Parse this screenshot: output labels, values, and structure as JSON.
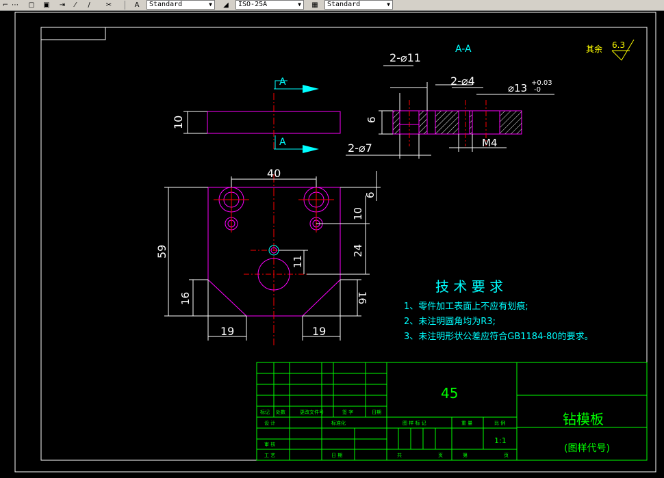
{
  "toolbar": {
    "text_style": "Standard",
    "dim_style": "ISO-25A",
    "table_style": "Standard"
  },
  "drawing": {
    "section_label": "A-A",
    "roughness_other": "其余",
    "roughness_value": "6.3",
    "cut_label_top": "A",
    "cut_label_bottom": "A",
    "dim_side_thickness": "10",
    "dim_2x11": "2-⌀11",
    "dim_2x4": "2-⌀4",
    "dim_13": "⌀13",
    "dim_13_tol_upper": "+0.03",
    "dim_13_tol_lower": "-0",
    "dim_section_thickness": "6",
    "dim_2x7": "2-⌀7",
    "dim_m4": "M4",
    "dim_width_40": "40",
    "dim_6": "6",
    "dim_10": "10",
    "dim_59": "59",
    "dim_24": "24",
    "dim_11": "11",
    "dim_16_left": "16",
    "dim_16_right": "16",
    "dim_19_left": "19",
    "dim_19_right": "19"
  },
  "tech_requirements": {
    "title": "技 术 要 求",
    "items": [
      "1、零件加工表面上不应有划痕;",
      "2、未注明圆角均为R3;",
      "3、未注明形状公差应符合GB1184-80的要求。"
    ]
  },
  "title_block": {
    "material": "45",
    "part_name": "钻模板",
    "drawing_code": "(图样代号)",
    "scale": "1:1",
    "labels": {
      "mark": "标记",
      "count": "处数",
      "change_doc": "更改文件号",
      "sign": "签 字",
      "date": "日期",
      "design": "设 计",
      "standardize": "标准化",
      "stage_mark": "图 样 标 记",
      "weight": "重 量",
      "scale": "比 例",
      "review": "审 核",
      "process": "工 艺",
      "date2": "日 期",
      "total": "共",
      "sheet": "页",
      "nth": "第",
      "page": "页"
    }
  },
  "colors": {
    "background": "#000000",
    "frame": "#ffffff",
    "outline": "#ff00ff",
    "center": "#ff0000",
    "dimension": "#ffffff",
    "cyan": "#00ffff",
    "title_block": "#00ff00",
    "roughness": "#ffff00"
  }
}
